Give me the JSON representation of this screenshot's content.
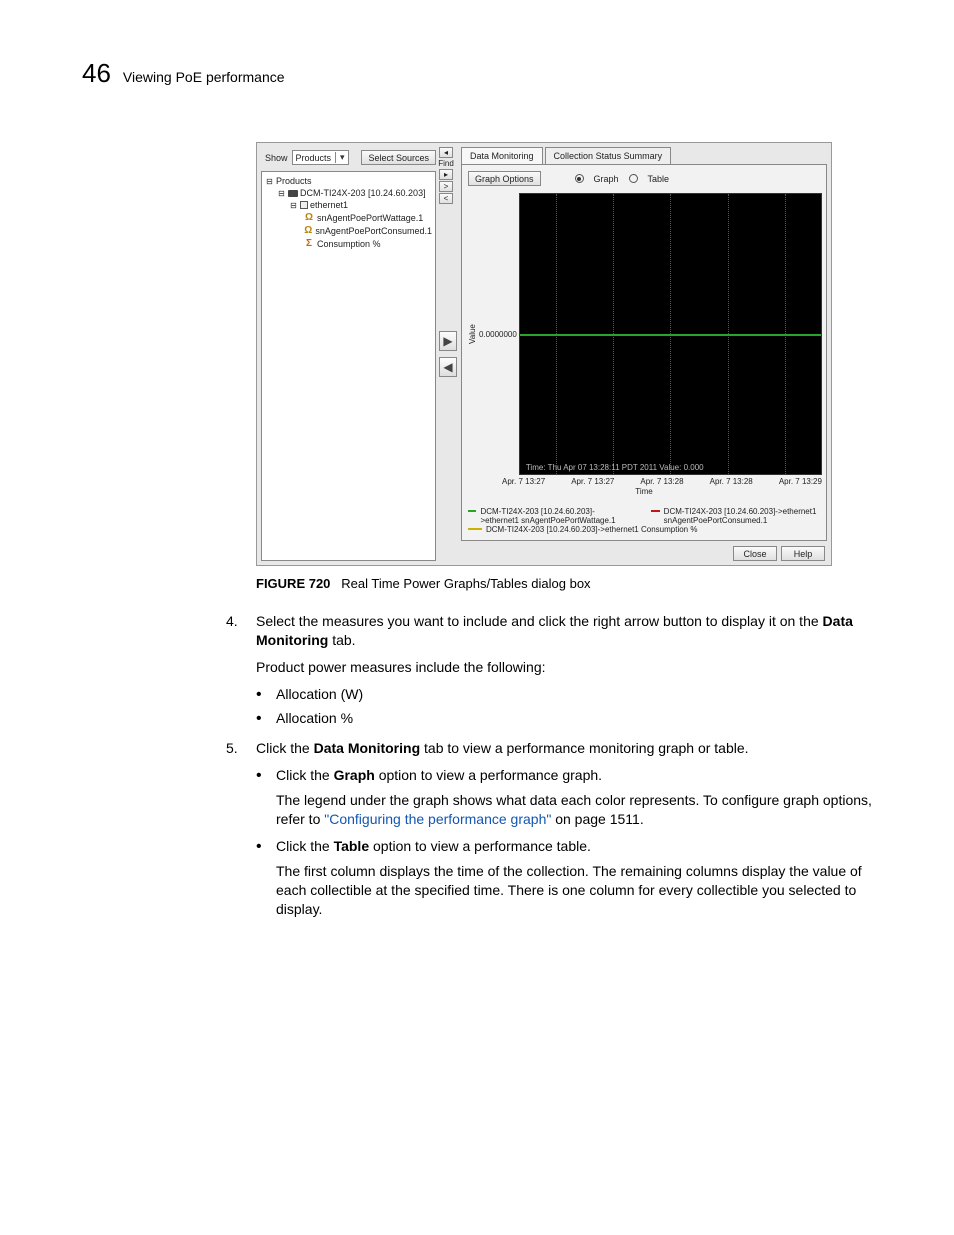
{
  "header": {
    "page_number": "46",
    "title": "Viewing PoE performance"
  },
  "dialog": {
    "show_label": "Show",
    "show_combo": "Products",
    "select_sources_btn": "Select Sources",
    "find_label": "Find",
    "tree": {
      "root": "Products",
      "device": "DCM-TI24X-203 [10.24.60.203]",
      "port": "ethernet1",
      "metrics": [
        "snAgentPoePortWattage.1",
        "snAgentPoePortConsumed.1",
        "Consumption %"
      ]
    },
    "tabs": {
      "data_monitoring": "Data Monitoring",
      "collection_status": "Collection Status Summary"
    },
    "graph_options_btn": "Graph Options",
    "radio_graph": "Graph",
    "radio_table": "Table",
    "tooltip": "Time: Thu Apr 07 13:28:11 PDT 2011 Value: 0.000",
    "legend": [
      {
        "color": "green",
        "text": "DCM-TI24X-203 [10.24.60.203]->ethernet1 snAgentPoePortWattage.1"
      },
      {
        "color": "red",
        "text": "DCM-TI24X-203 [10.24.60.203]->ethernet1 snAgentPoePortConsumed.1"
      },
      {
        "color": "yellow",
        "text": "DCM-TI24X-203 [10.24.60.203]->ethernet1 Consumption %"
      }
    ],
    "footer": {
      "close": "Close",
      "help": "Help"
    }
  },
  "chart_data": {
    "type": "line",
    "title": "",
    "xlabel": "Time",
    "ylabel": "Value",
    "ytick": "0.0000000",
    "xticks": [
      "Apr. 7 13:27",
      "Apr. 7 13:27",
      "Apr. 7 13:28",
      "Apr. 7 13:28",
      "Apr. 7 13:29"
    ],
    "ylim": [
      0,
      0
    ],
    "series": [
      {
        "name": "snAgentPoePortWattage.1",
        "color": "#29a329",
        "values": [
          0,
          0,
          0,
          0,
          0
        ]
      },
      {
        "name": "snAgentPoePortConsumed.1",
        "color": "#c01818",
        "values": [
          0,
          0,
          0,
          0,
          0
        ]
      },
      {
        "name": "Consumption %",
        "color": "#c8b400",
        "values": [
          0,
          0,
          0,
          0,
          0
        ]
      }
    ]
  },
  "caption": {
    "label": "FIGURE 720",
    "text": "Real Time Power Graphs/Tables dialog box"
  },
  "steps": {
    "s4_num": "4.",
    "s4_text_a": "Select the measures you want to include and click the right arrow button to display it on the ",
    "s4_bold": "Data Monitoring",
    "s4_text_b": " tab.",
    "s4_para": "Product power measures include the following:",
    "s4_bullets": [
      "Allocation (W)",
      "Allocation %"
    ],
    "s5_num": "5.",
    "s5_text_a": "Click the ",
    "s5_bold": "Data Monitoring",
    "s5_text_b": " tab to view a performance monitoring graph or table.",
    "s5_sub1_a": "Click the ",
    "s5_sub1_bold": "Graph",
    "s5_sub1_b": " option to view a performance graph.",
    "s5_sub1_para_a": "The legend under the graph shows what data each color represents. To configure graph options, refer to ",
    "s5_sub1_link": "\"Configuring the performance graph\"",
    "s5_sub1_para_b": " on page 1511.",
    "s5_sub2_a": "Click the ",
    "s5_sub2_bold": "Table",
    "s5_sub2_b": " option to view a performance table.",
    "s5_sub2_para": "The first column displays the time of the collection. The remaining columns display the value of each collectible at the specified time. There is one column for every collectible you selected to display."
  }
}
